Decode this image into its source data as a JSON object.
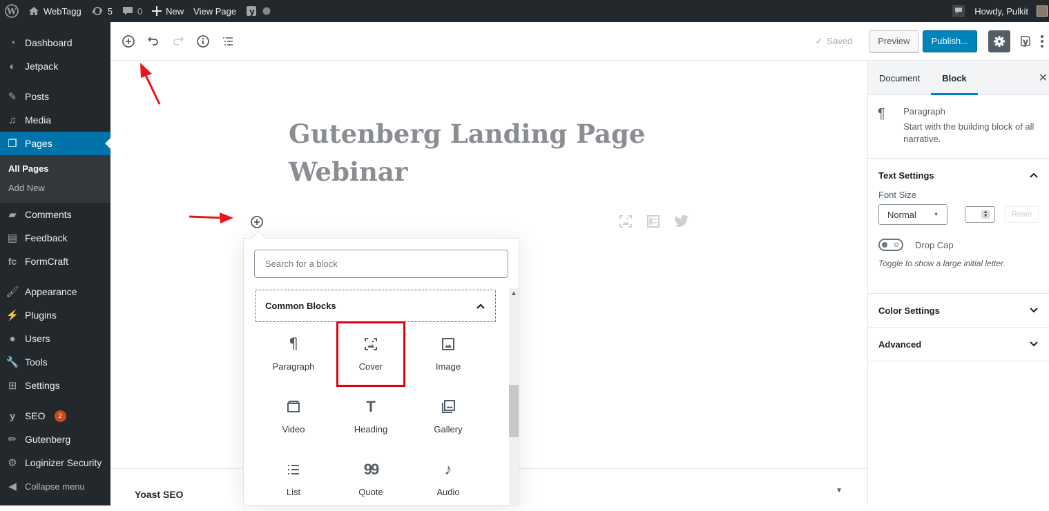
{
  "adminbar": {
    "site_name": "WebTagg",
    "updates_count": "5",
    "comments_count": "0",
    "new_label": "New",
    "view_page_label": "View Page",
    "howdy": "Howdy, Pulkit"
  },
  "sidebar": {
    "items": [
      {
        "label": "Dashboard",
        "icon": "dashboard-icon"
      },
      {
        "label": "Jetpack",
        "icon": "jetpack-icon"
      },
      {
        "label": "Posts",
        "icon": "pin-icon"
      },
      {
        "label": "Media",
        "icon": "media-icon"
      },
      {
        "label": "Pages",
        "icon": "pages-icon",
        "active": true
      },
      {
        "label": "Comments",
        "icon": "comment-icon"
      },
      {
        "label": "Feedback",
        "icon": "feedback-icon"
      },
      {
        "label": "FormCraft",
        "icon": "formcraft-icon"
      },
      {
        "label": "Appearance",
        "icon": "brush-icon"
      },
      {
        "label": "Plugins",
        "icon": "plugin-icon"
      },
      {
        "label": "Users",
        "icon": "user-icon"
      },
      {
        "label": "Tools",
        "icon": "wrench-icon"
      },
      {
        "label": "Settings",
        "icon": "settings-icon"
      },
      {
        "label": "SEO",
        "icon": "yoast-icon",
        "badge": "2"
      },
      {
        "label": "Gutenberg",
        "icon": "pencil-icon"
      },
      {
        "label": "Loginizer Security",
        "icon": "gear-icon"
      },
      {
        "label": "Collapse menu",
        "icon": "collapse-icon"
      }
    ],
    "submenu": [
      "All Pages",
      "Add New"
    ]
  },
  "toolbar": {
    "saved_label": "Saved",
    "preview_label": "Preview",
    "publish_label": "Publish..."
  },
  "editor": {
    "title": "Gutenberg Landing Page Webinar"
  },
  "inserter": {
    "search_placeholder": "Search for a block",
    "panel_title": "Common Blocks",
    "blocks": [
      {
        "label": "Paragraph",
        "icon": "paragraph-icon"
      },
      {
        "label": "Cover",
        "icon": "cover-icon",
        "highlighted": true
      },
      {
        "label": "Image",
        "icon": "image-icon"
      },
      {
        "label": "Video",
        "icon": "video-icon"
      },
      {
        "label": "Heading",
        "icon": "heading-icon"
      },
      {
        "label": "Gallery",
        "icon": "gallery-icon"
      },
      {
        "label": "List",
        "icon": "list-icon"
      },
      {
        "label": "Quote",
        "icon": "quote-icon"
      },
      {
        "label": "Audio",
        "icon": "audio-icon"
      }
    ]
  },
  "metabox": {
    "yoast_label": "Yoast SEO"
  },
  "settings": {
    "tabs": [
      "Document",
      "Block"
    ],
    "active_tab": "Block",
    "block_name": "Paragraph",
    "block_desc": "Start with the building block of all narrative.",
    "text_settings": "Text Settings",
    "font_size_label": "Font Size",
    "font_size_value": "Normal",
    "reset_label": "Reset",
    "drop_cap_label": "Drop Cap",
    "drop_cap_help": "Toggle to show a large initial letter.",
    "color_settings": "Color Settings",
    "advanced": "Advanced"
  },
  "colors": {
    "admin_dark": "#23282d",
    "accent": "#0085ba",
    "highlight": "#e0000a"
  }
}
